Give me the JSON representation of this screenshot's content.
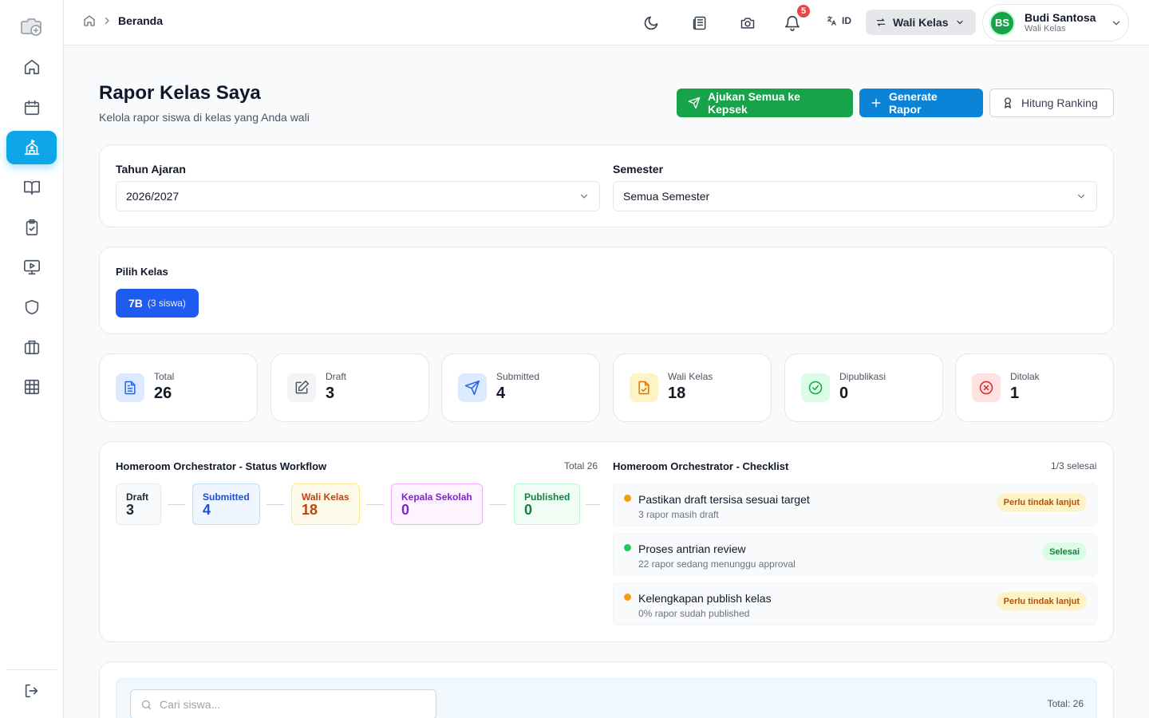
{
  "breadcrumb": {
    "current": "Beranda"
  },
  "topbar": {
    "notification_count": "5",
    "language": "ID",
    "role": "Wali Kelas",
    "user": {
      "initials": "BS",
      "name": "Budi Santosa",
      "role": "Wali Kelas"
    }
  },
  "header": {
    "title": "Rapor Kelas Saya",
    "subtitle": "Kelola rapor siswa di kelas yang Anda wali",
    "btn_submit_all": "Ajukan Semua ke Kepsek",
    "btn_generate": "Generate Rapor",
    "btn_ranking": "Hitung Ranking"
  },
  "filters": {
    "year_label": "Tahun Ajaran",
    "year_value": "2026/2027",
    "semester_label": "Semester",
    "semester_value": "Semua Semester"
  },
  "class_picker": {
    "label": "Pilih Kelas",
    "classes": [
      {
        "name": "7B",
        "count": "(3 siswa)"
      }
    ]
  },
  "stats": [
    {
      "label": "Total",
      "value": "26",
      "icon": "document-icon",
      "bg": "#dbeafe",
      "color": "#2563eb"
    },
    {
      "label": "Draft",
      "value": "3",
      "icon": "edit-icon",
      "bg": "#f3f4f6",
      "color": "#4b5563"
    },
    {
      "label": "Submitted",
      "value": "4",
      "icon": "send-icon",
      "bg": "#dbeafe",
      "color": "#2563eb"
    },
    {
      "label": "Wali Kelas",
      "value": "18",
      "icon": "file-check-icon",
      "bg": "#fef3c7",
      "color": "#d97706"
    },
    {
      "label": "Dipublikasi",
      "value": "0",
      "icon": "check-circle-icon",
      "bg": "#dcfce7",
      "color": "#16a34a"
    },
    {
      "label": "Ditolak",
      "value": "1",
      "icon": "x-circle-icon",
      "bg": "#fee2e2",
      "color": "#dc2626"
    }
  ],
  "workflow": {
    "title": "Homeroom Orchestrator - Status Workflow",
    "total": "Total 26",
    "stages": [
      {
        "label": "Draft",
        "value": "3"
      },
      {
        "label": "Submitted",
        "value": "4"
      },
      {
        "label": "Wali Kelas",
        "value": "18"
      },
      {
        "label": "Kepala Sekolah",
        "value": "0"
      },
      {
        "label": "Published",
        "value": "0"
      }
    ]
  },
  "checklist": {
    "title": "Homeroom Orchestrator - Checklist",
    "progress": "1/3 selesai",
    "items": [
      {
        "title": "Pastikan draft tersisa sesuai target",
        "sub": "3 rapor masih draft",
        "badge": "Perlu tindak lanjut",
        "status_color": "#f59e0b"
      },
      {
        "title": "Proses antrian review",
        "sub": "22 rapor sedang menunggu approval",
        "badge": "Selesai",
        "status_color": "#22c55e"
      },
      {
        "title": "Kelengkapan publish kelas",
        "sub": "0% rapor sudah published",
        "badge": "Perlu tindak lanjut",
        "status_color": "#f59e0b"
      }
    ]
  },
  "list": {
    "search_placeholder": "Cari siswa...",
    "total": "Total: 26"
  }
}
